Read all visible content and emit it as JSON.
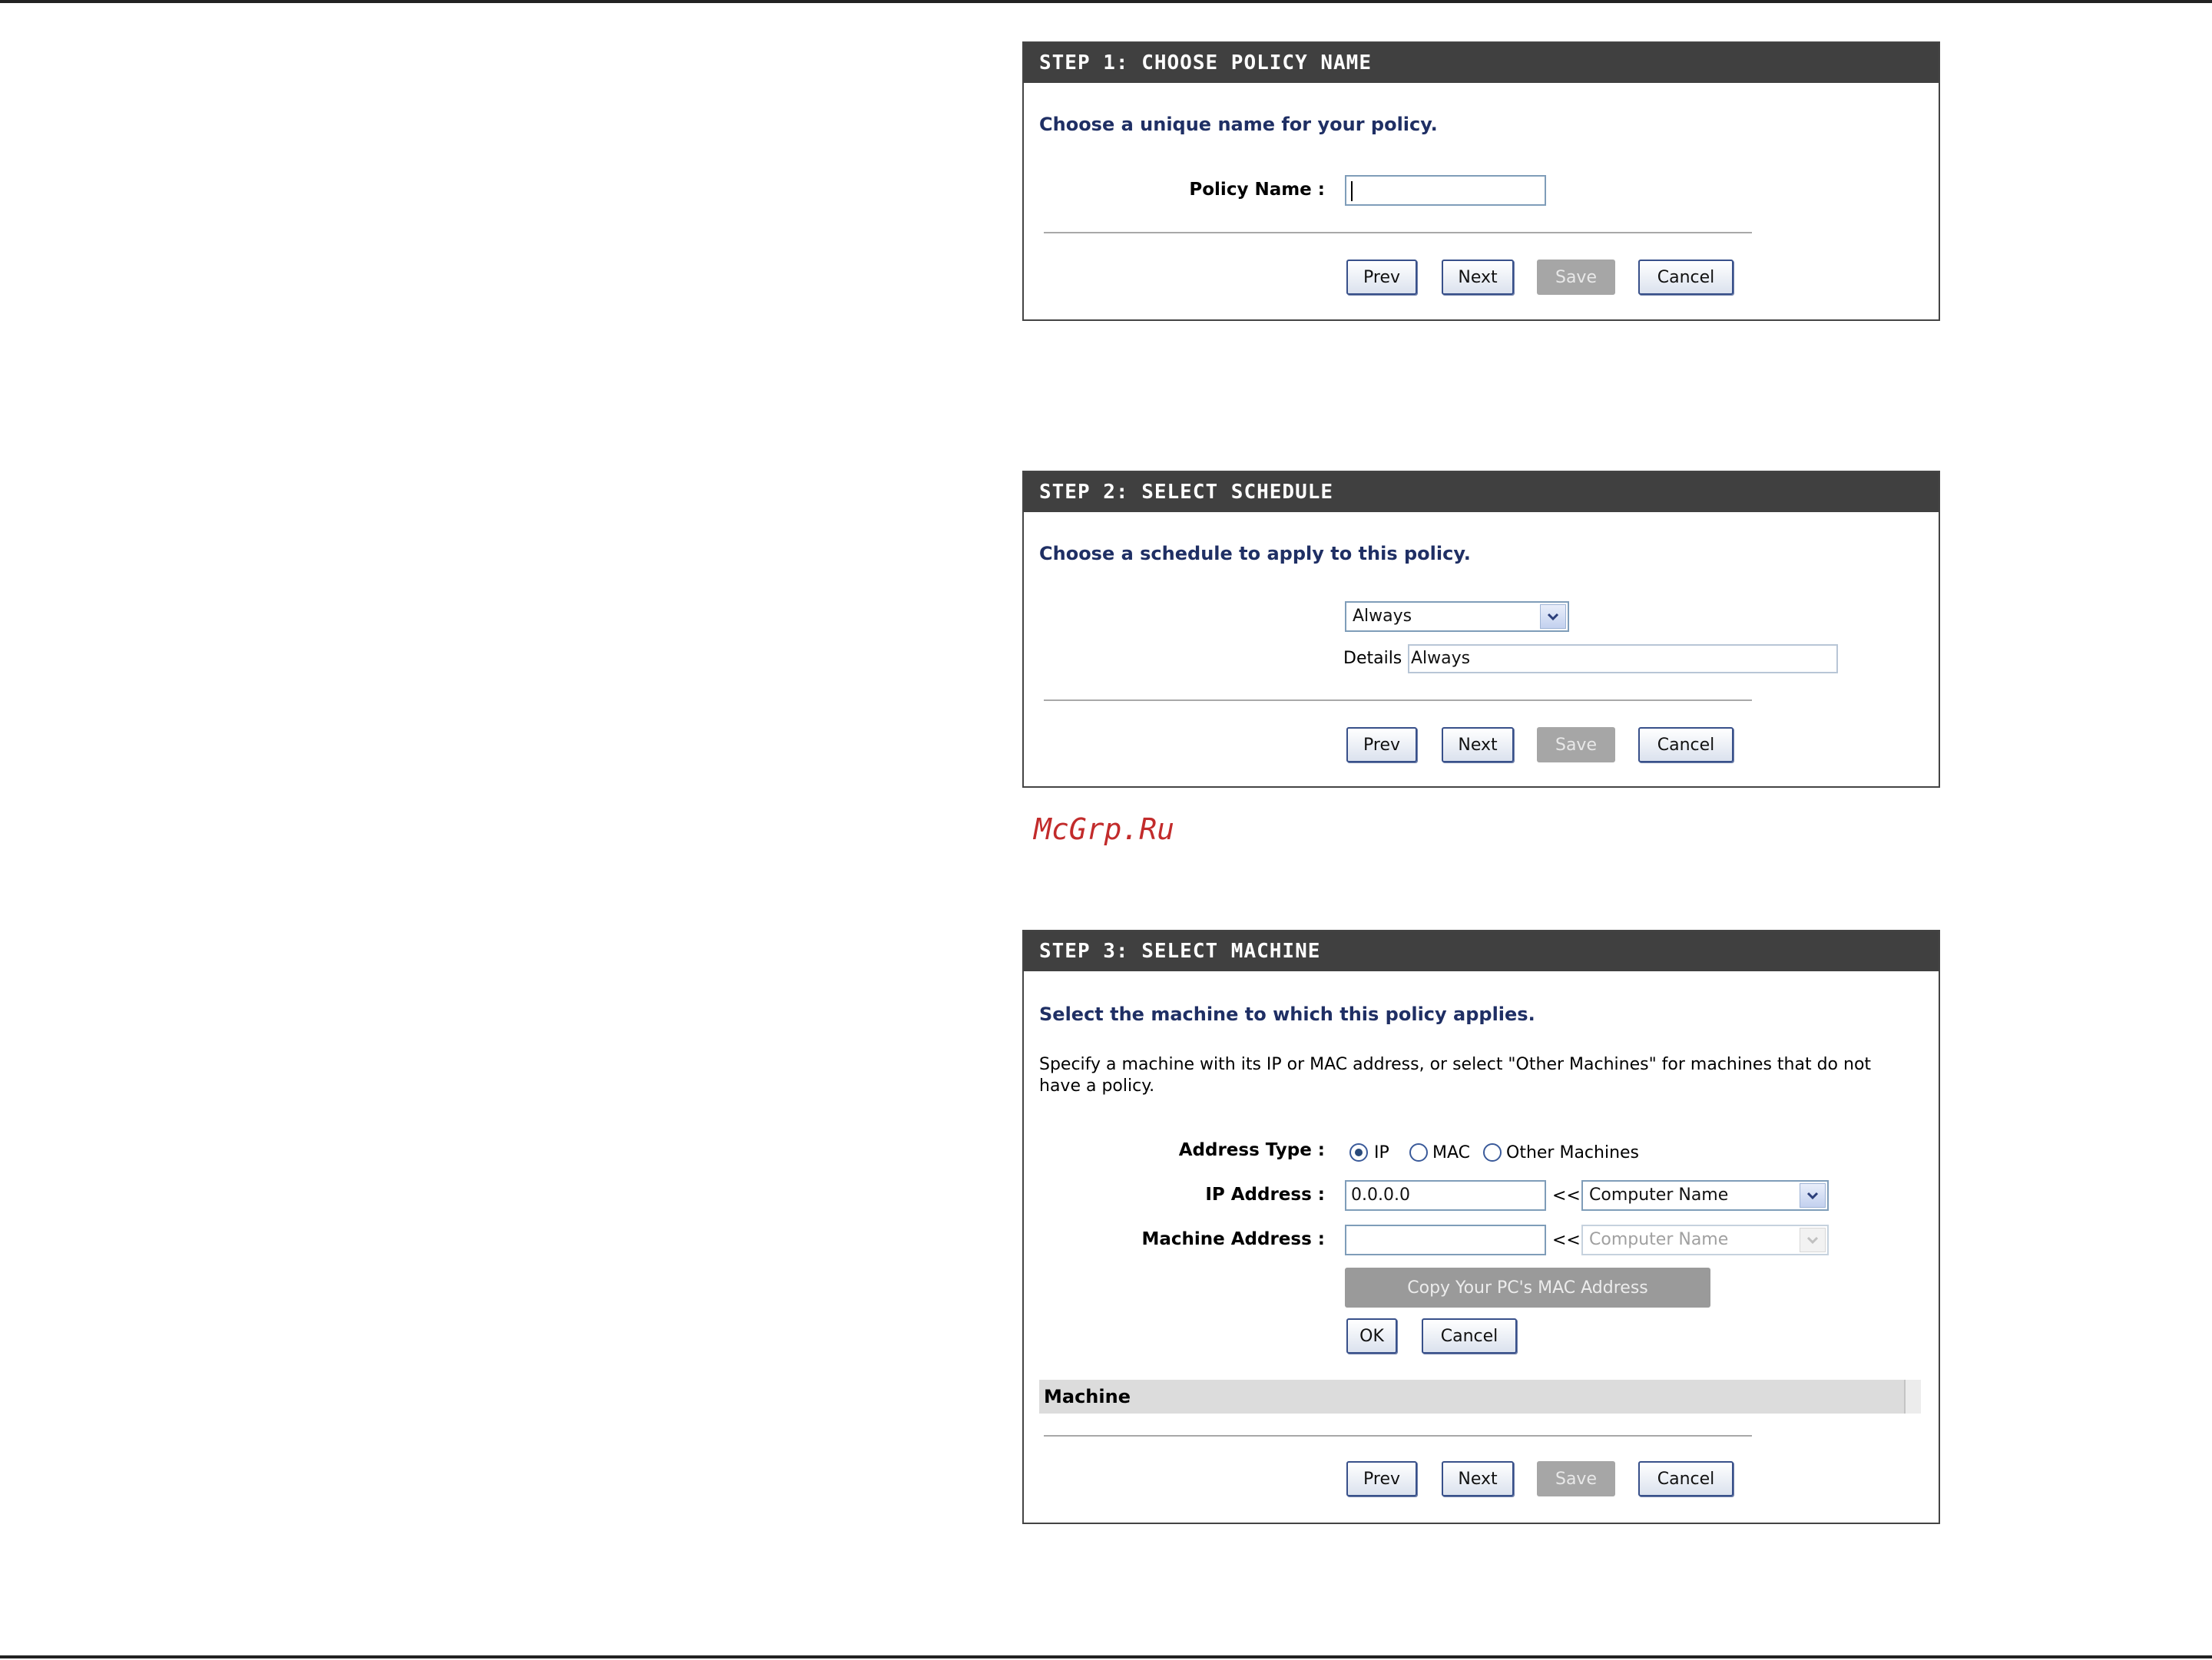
{
  "step1": {
    "header": "STEP 1: CHOOSE POLICY NAME",
    "intro": "Choose a unique name for your policy.",
    "policy_name_label": "Policy Name :",
    "policy_name_value": "",
    "buttons": {
      "prev": "Prev",
      "next": "Next",
      "save": "Save",
      "cancel": "Cancel"
    }
  },
  "step2": {
    "header": "STEP 2: SELECT SCHEDULE",
    "intro": "Choose a schedule to apply to this policy.",
    "schedule_selected": "Always",
    "details_label": "Details :",
    "details_value": "Always",
    "buttons": {
      "prev": "Prev",
      "next": "Next",
      "save": "Save",
      "cancel": "Cancel"
    }
  },
  "watermark": "McGrp.Ru",
  "step3": {
    "header": "STEP 3: SELECT MACHINE",
    "intro": "Select the machine to which this policy applies.",
    "description": "Specify a machine with its IP or MAC address, or select \"Other Machines\" for machines that do not have a policy.",
    "address_type_label": "Address Type :",
    "address_type_options": [
      "IP",
      "MAC",
      "Other Machines"
    ],
    "address_type_selected": "IP",
    "ip_address_label": "IP Address :",
    "ip_address_value": "0.0.0.0",
    "ip_arrow": "<<",
    "ip_computer_select": "Computer Name",
    "machine_address_label": "Machine Address :",
    "machine_address_value": "",
    "machine_arrow": "<<",
    "machine_computer_select": "Computer Name",
    "copy_mac_button": "Copy Your PC's MAC Address",
    "ok_button": "OK",
    "cancel_button": "Cancel",
    "table_header": "Machine",
    "buttons": {
      "prev": "Prev",
      "next": "Next",
      "save": "Save",
      "cancel": "Cancel"
    }
  }
}
